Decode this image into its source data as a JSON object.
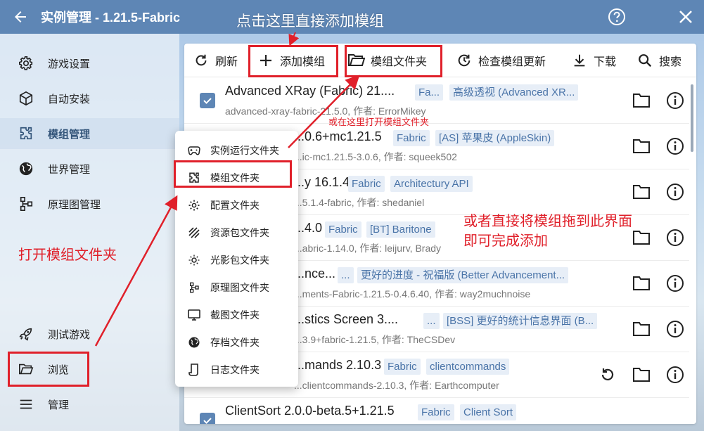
{
  "window": {
    "title": "实例管理 - 1.21.5-Fabric"
  },
  "sidebar": {
    "items": [
      {
        "label": "游戏设置",
        "icon": "gear-icon"
      },
      {
        "label": "自动安装",
        "icon": "cube-icon"
      },
      {
        "label": "模组管理",
        "icon": "puzzle-icon"
      },
      {
        "label": "世界管理",
        "icon": "globe-icon"
      },
      {
        "label": "原理图管理",
        "icon": "schematic-icon"
      }
    ],
    "bottom": [
      {
        "label": "测试游戏",
        "icon": "rocket-icon"
      },
      {
        "label": "浏览",
        "icon": "folder-open-icon"
      },
      {
        "label": "管理",
        "icon": "menu-icon"
      }
    ]
  },
  "toolbar": {
    "refresh": "刷新",
    "add_mod": "添加模组",
    "mod_folder": "模组文件夹",
    "check_updates": "检查模组更新",
    "download": "下载",
    "search": "搜索"
  },
  "mods": [
    {
      "name": "Advanced XRay (Fabric) 21....",
      "tags": [
        "Fa...",
        "高级透视 (Advanced XR..."
      ],
      "sub": "advanced-xray-fabric-21.5.0, 作者: ErrorMikey"
    },
    {
      "name": "...0.6+mc1.21.5",
      "tags": [
        "Fabric",
        "[AS] 苹果皮 (AppleSkin)"
      ],
      "sub": "...ic-mc1.21.5-3.0.6, 作者: squeek502"
    },
    {
      "name": "...y 16.1.4",
      "tags": [
        "Fabric",
        "Architectury API"
      ],
      "sub": "...5.1.4-fabric, 作者: shedaniel"
    },
    {
      "name": "...4.0",
      "tags": [
        "Fabric",
        "[BT] Baritone"
      ],
      "sub": "...abric-1.14.0, 作者: leijurv, Brady"
    },
    {
      "name": "...nce...",
      "tags": [
        "...",
        "更好的进度 - 祝福版 (Better Advancement..."
      ],
      "sub": "...ments-Fabric-1.21.5-0.4.6.40, 作者: way2muchnoise"
    },
    {
      "name": "...stics Screen 3....",
      "tags": [
        "...",
        "[BSS] 更好的统计信息界面 (B..."
      ],
      "sub": "...3.9+fabric-1.21.5, 作者: TheCSDev"
    },
    {
      "name": "...mands 2.10.3",
      "tags": [
        "Fabric",
        "clientcommands"
      ],
      "sub": "...clientcommands-2.10.3, 作者: Earthcomputer"
    },
    {
      "name": "ClientSort 2.0.0-beta.5+1.21.5",
      "tags": [
        "Fabric",
        "Client Sort"
      ],
      "sub": ""
    }
  ],
  "menu": {
    "items": [
      {
        "label": "实例运行文件夹",
        "icon": "gamepad-icon"
      },
      {
        "label": "模组文件夹",
        "icon": "puzzle-icon"
      },
      {
        "label": "配置文件夹",
        "icon": "gear-icon"
      },
      {
        "label": "资源包文件夹",
        "icon": "texture-icon"
      },
      {
        "label": "光影包文件夹",
        "icon": "sun-icon"
      },
      {
        "label": "原理图文件夹",
        "icon": "schematic-icon"
      },
      {
        "label": "截图文件夹",
        "icon": "monitor-icon"
      },
      {
        "label": "存档文件夹",
        "icon": "globe-icon"
      },
      {
        "label": "日志文件夹",
        "icon": "log-icon"
      }
    ]
  },
  "annotations": {
    "top": "点击这里直接添加模组",
    "open_here": "或在这里打开模组文件夹",
    "drag_line1": "或者直接将模组拖到此界面",
    "drag_line2": "即可完成添加",
    "open_folder": "打开模组文件夹"
  },
  "colors": {
    "accent": "#5e86b5",
    "annotation": "#e0202a",
    "tag_bg": "#e7eef7",
    "tag_text": "#4a74a8"
  }
}
